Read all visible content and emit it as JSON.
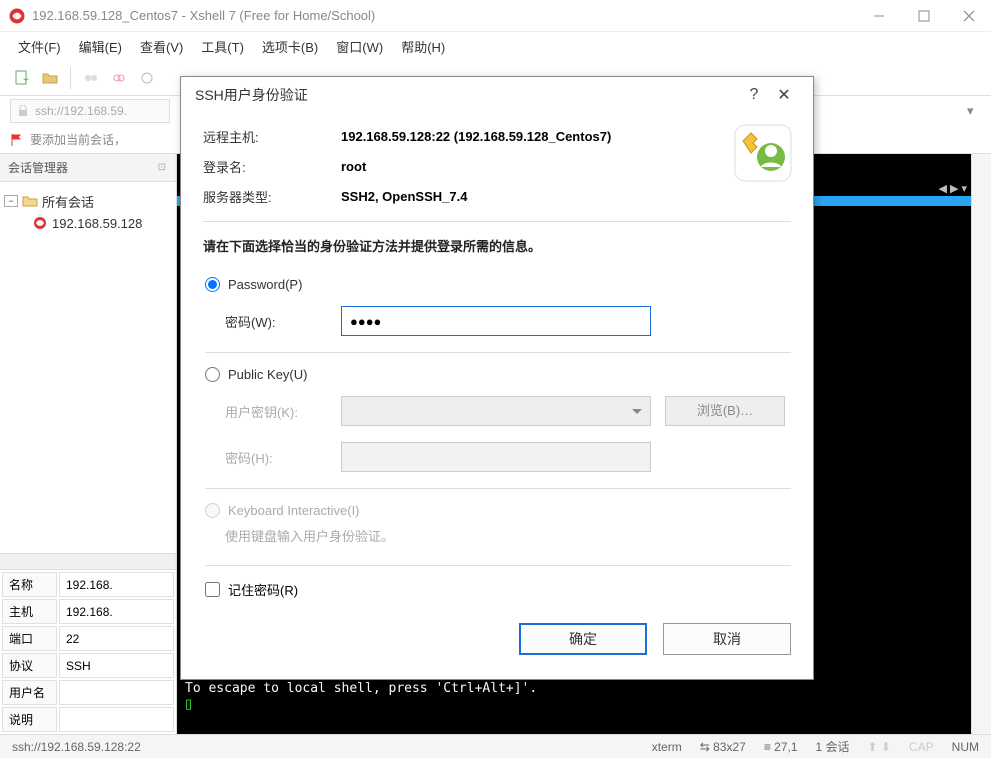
{
  "title": "192.168.59.128_Centos7 - Xshell 7 (Free for Home/School)",
  "menu": [
    "文件(F)",
    "编辑(E)",
    "查看(V)",
    "工具(T)",
    "选项卡(B)",
    "窗口(W)",
    "帮助(H)"
  ],
  "address": "ssh://192.168.59.",
  "quick_text": "要添加当前会话，",
  "sidebar": {
    "header": "会话管理器",
    "root": "所有会话",
    "child": "192.168.59.128"
  },
  "props": {
    "name_k": "名称",
    "name_v": "192.168.",
    "host_k": "主机",
    "host_v": "192.168.",
    "port_k": "端口",
    "port_v": "22",
    "proto_k": "协议",
    "proto_v": "SSH",
    "user_k": "用户名",
    "user_v": "",
    "desc_k": "说明",
    "desc_v": ""
  },
  "terminal": {
    "escape": "To escape to local shell, press 'Ctrl+Alt+]'.",
    "prompt": "▯"
  },
  "status": {
    "uri": "ssh://192.168.59.128:22",
    "term": "xterm",
    "size": "⇆ 83x27",
    "pos": "≡ 27,1",
    "sessions": "1 会话",
    "cap": "CAP",
    "num": "NUM"
  },
  "dialog": {
    "title": "SSH用户身份验证",
    "remote_host_lbl": "远程主机:",
    "remote_host": "192.168.59.128:22 (192.168.59.128_Centos7)",
    "login_lbl": "登录名:",
    "login": "root",
    "server_lbl": "服务器类型:",
    "server": "SSH2, OpenSSH_7.4",
    "instruction": "请在下面选择恰当的身份验证方法并提供登录所需的信息。",
    "password_radio": "Password(P)",
    "password_lbl": "密码(W):",
    "password_value": "●●●●",
    "pubkey_radio": "Public Key(U)",
    "userkey_lbl": "用户密钥(K):",
    "browse": "浏览(B)…",
    "passphrase_lbl": "密码(H):",
    "ki_radio": "Keyboard Interactive(I)",
    "ki_note": "使用键盘输入用户身份验证。",
    "remember": "记住密码(R)",
    "ok": "确定",
    "cancel": "取消"
  }
}
